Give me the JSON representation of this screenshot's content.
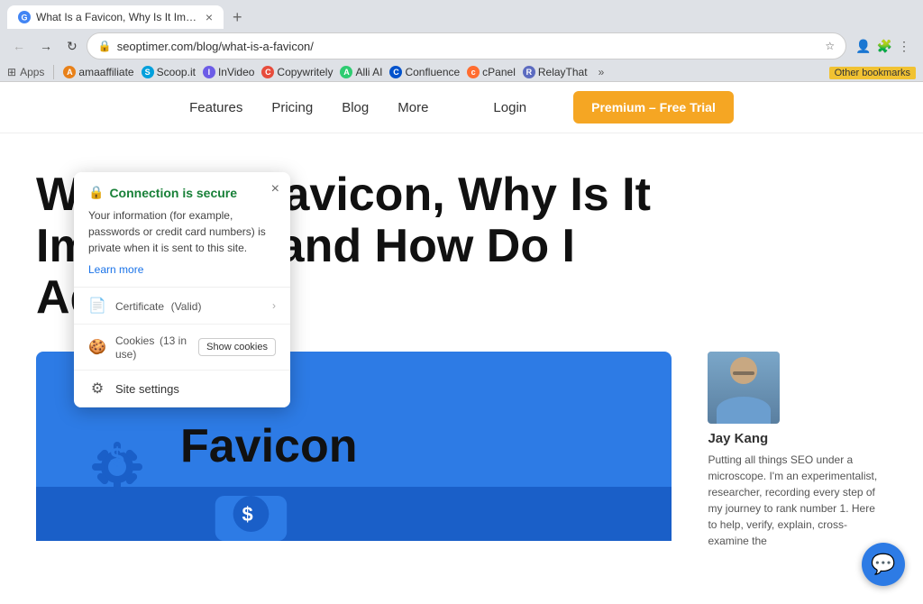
{
  "browser": {
    "tab": {
      "title": "What Is a Favicon, Why Is It Imp...",
      "favicon_char": "G"
    },
    "address": "seoptimer.com/blog/what-is-a-favicon/",
    "nav": {
      "back_label": "←",
      "forward_label": "→",
      "reload_label": "↻",
      "home_label": "⊙"
    }
  },
  "bookmarks": {
    "apps_label": "Apps",
    "items": [
      {
        "label": "amaaffiliate",
        "color": "#e8811a"
      },
      {
        "label": "Scoop.it",
        "color": "#00a0dc"
      },
      {
        "label": "InVideo",
        "color": "#6c5ce7"
      },
      {
        "label": "Copywritely",
        "color": "#e74c3c"
      },
      {
        "label": "Alli AI",
        "color": "#2ecc71"
      },
      {
        "label": "Confluence",
        "color": "#0052cc"
      },
      {
        "label": "cPanel",
        "color": "#ff6c2f"
      },
      {
        "label": "RelayThat",
        "color": "#5c6bc0"
      }
    ],
    "more_label": "»",
    "other_label": "Other bookmarks"
  },
  "navbar": {
    "features_label": "Features",
    "pricing_label": "Pricing",
    "blog_label": "Blog",
    "more_label": "More",
    "login_label": "Login",
    "cta_label": "Premium – Free Trial"
  },
  "hero": {
    "title": "What Is a Favicon, Why Is It Important, and How Do I Add One?"
  },
  "favicon_section": {
    "gear_symbol": "⚙",
    "text": "Favicon"
  },
  "author": {
    "name": "Jay Kang",
    "bio": "Putting all things SEO under a microscope. I'm an experimentalist, researcher, recording every step of my journey to rank number 1. Here to help, verify, explain, cross-examine the"
  },
  "popup": {
    "secure_label": "Connection is secure",
    "secure_icon": "🔒",
    "description": "Your information (for example, passwords or credit card numbers) is private when it is sent to this site.",
    "learn_more": "Learn more",
    "close_label": "×",
    "certificate_label": "Certificate",
    "certificate_detail": "(Valid)",
    "cookies_label": "Cookies",
    "cookies_detail": "13 in use",
    "show_cookies_label": "Show cookies",
    "site_settings_label": "Site settings"
  },
  "chat": {
    "icon": "💬"
  }
}
